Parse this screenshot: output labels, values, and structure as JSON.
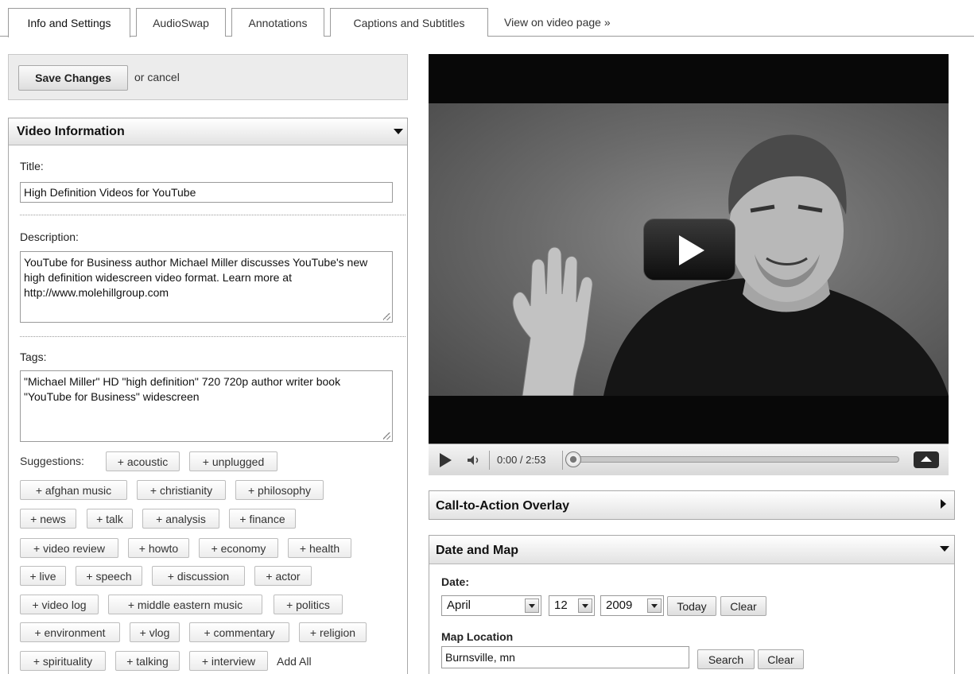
{
  "tabs": [
    {
      "label": "Info and Settings"
    },
    {
      "label": "AudioSwap"
    },
    {
      "label": "Annotations"
    },
    {
      "label": "Captions and Subtitles"
    },
    {
      "label": "View on video page »"
    }
  ],
  "actions": {
    "save_label": "Save Changes",
    "cancel_text": "or cancel"
  },
  "video_info": {
    "title": "Video Information",
    "title_label": "Title:",
    "title_value": "High Definition Videos for YouTube",
    "description_label": "Description:",
    "description_value": "YouTube for Business author Michael Miller discusses YouTube's new high definition widescreen video format. Learn more at http://www.molehillgroup.com",
    "tags_label": "Tags:",
    "tags_value": "\"Michael Miller\" HD \"high definition\" 720 720p author writer book \"YouTube for Business\" widescreen",
    "suggestions_label": "Suggestions:",
    "suggestions": [
      "+ acoustic",
      "+ unplugged",
      "+ afghan music",
      "+ christianity",
      "+ philosophy",
      "+ news",
      "+ talk",
      "+ analysis",
      "+ finance",
      "+ video review",
      "+ howto",
      "+ economy",
      "+ health",
      "+ live",
      "+ speech",
      "+ discussion",
      "+ actor",
      "+ video log",
      "+ middle eastern music",
      "+ politics",
      "+ environment",
      "+ vlog",
      "+ commentary",
      "+ religion",
      "+ spirituality",
      "+ talking",
      "+ interview"
    ],
    "add_all": "Add All"
  },
  "player": {
    "time": "0:00 / 2:53",
    "progress": 0
  },
  "cta": {
    "title": "Call-to-Action Overlay"
  },
  "date_map": {
    "title": "Date and Map",
    "date_label": "Date:",
    "month": "April",
    "day": "12",
    "year": "2009",
    "today_label": "Today",
    "clear_label": "Clear",
    "map_label": "Map Location",
    "map_value": "Burnsville, mn",
    "search_label": "Search",
    "clear2_label": "Clear"
  }
}
